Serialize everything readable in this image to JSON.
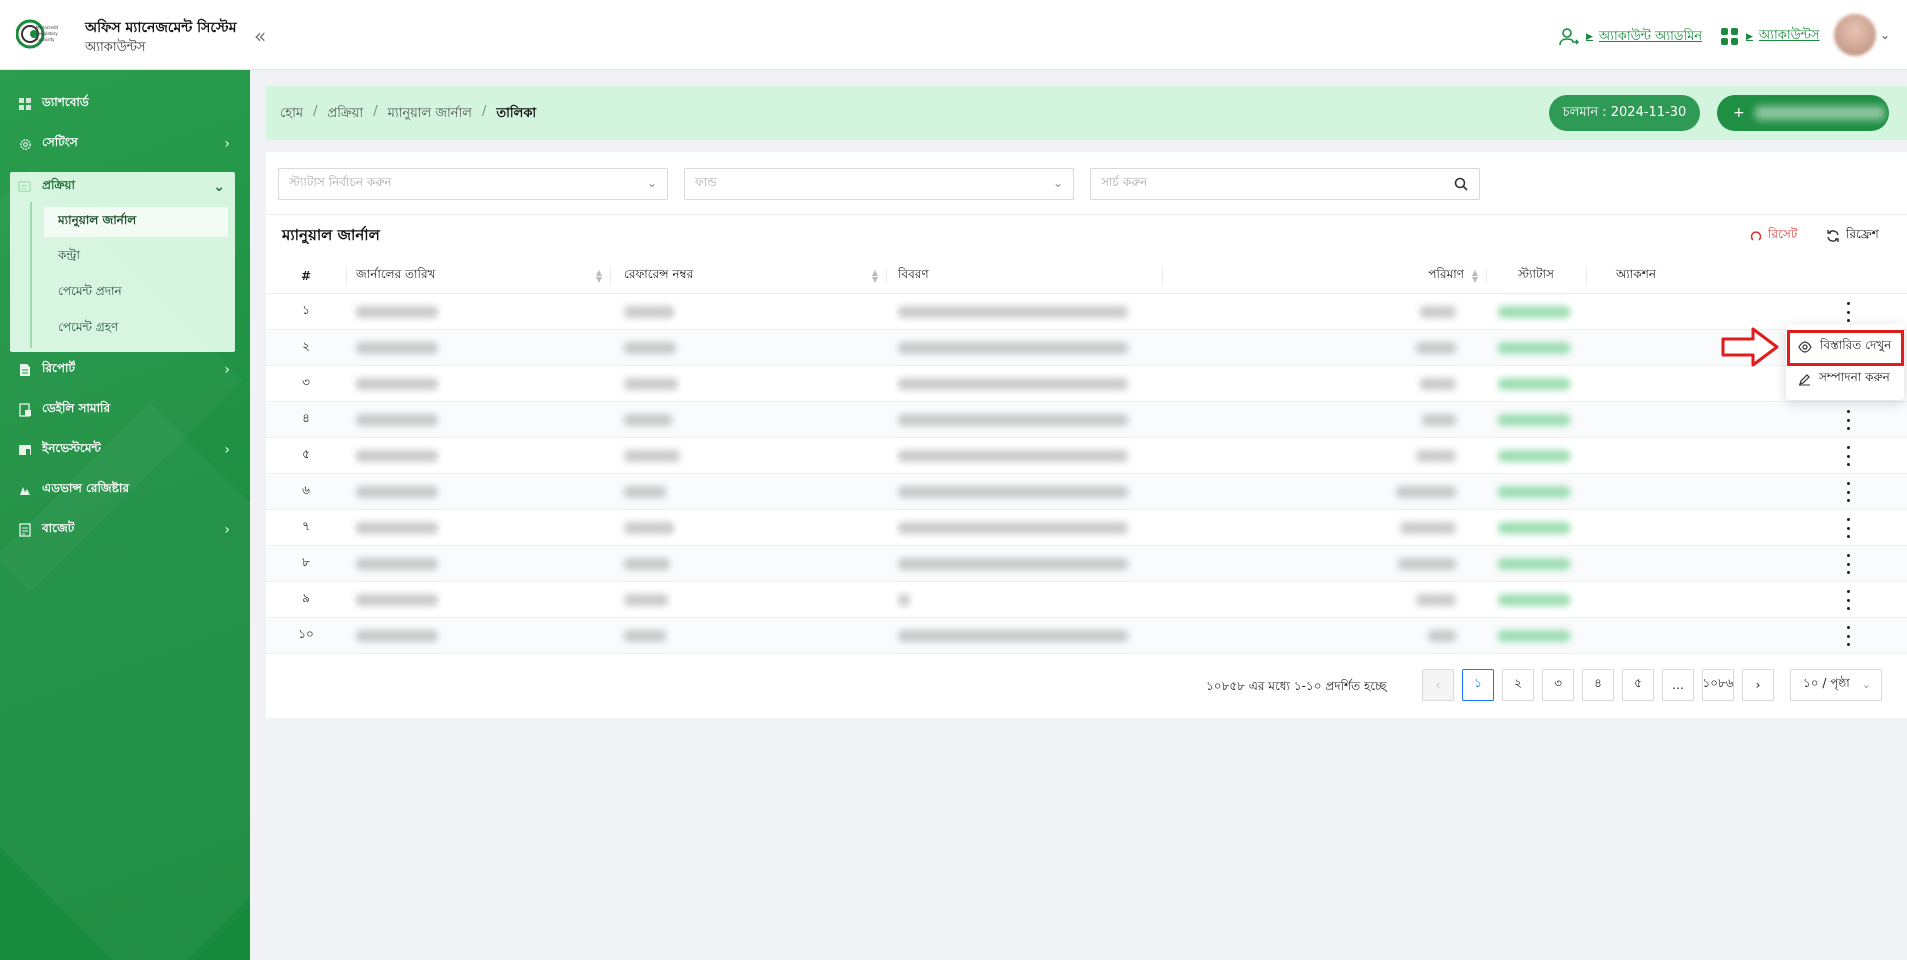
{
  "header": {
    "app_title": "অফিস ম্যানেজমেন্ট সিস্টেম",
    "app_subtitle": "অ্যাকাউন্টস",
    "logo_lines": [
      "Microcredit",
      "Regulatory",
      "Authority"
    ],
    "role_link": "অ্যাকাউন্ট অ্যাডমিন",
    "module_link": "অ্যাকাউন্টস",
    "brand_color": "#1a8a3c"
  },
  "sidebar": {
    "items": [
      {
        "label": "ড্যাশবোর্ড",
        "icon": "dashboard-icon",
        "has_children": false
      },
      {
        "label": "সেটিংস",
        "icon": "gear-icon",
        "has_children": true
      },
      {
        "label": "প্রক্রিয়া",
        "icon": "process-icon",
        "has_children": true,
        "expanded": true
      },
      {
        "label": "রিপোর্ট",
        "icon": "report-icon",
        "has_children": true
      },
      {
        "label": "ডেইলি সামারি",
        "icon": "summary-icon",
        "has_children": false
      },
      {
        "label": "ইনভেস্টমেন্ট",
        "icon": "investment-icon",
        "has_children": true
      },
      {
        "label": "এডভান্স রেজিষ্টার",
        "icon": "register-icon",
        "has_children": false
      },
      {
        "label": "বাজেট",
        "icon": "budget-icon",
        "has_children": true
      }
    ],
    "sub_items": [
      {
        "label": "ম্যানুয়াল জার্নাল",
        "active": true
      },
      {
        "label": "কন্ট্রা",
        "active": false
      },
      {
        "label": "পেমেন্ট প্রদান",
        "active": false
      },
      {
        "label": "পেমেন্ট গ্রহণ",
        "active": false
      }
    ]
  },
  "breadcrumb": {
    "items": [
      "হোম",
      "প্রক্রিয়া",
      "ম্যানুয়াল জার্নাল",
      "তালিকা"
    ],
    "fiscal_year": "চলমান : 2024-11-30",
    "add_button_prefix": "+"
  },
  "filters": {
    "status_placeholder": "স্ট্যাটাস নির্বাচন করুন",
    "fund_placeholder": "ফান্ড",
    "search_placeholder": "সার্চ করুন"
  },
  "table": {
    "title": "ম্যানুয়াল জার্নাল",
    "reset_label": "রিসেট",
    "refresh_label": "রিফ্রেশ",
    "columns": [
      "#",
      "জার্নালের তারিখ",
      "রেফারেন্স নম্বর",
      "বিবরণ",
      "পরিমাণ",
      "স্ট্যাটাস",
      "অ্যাকশন"
    ],
    "rows": [
      {
        "index": "১"
      },
      {
        "index": "২"
      },
      {
        "index": "৩"
      },
      {
        "index": "৪"
      },
      {
        "index": "৫"
      },
      {
        "index": "৬"
      },
      {
        "index": "৭"
      },
      {
        "index": "৮"
      },
      {
        "index": "৯"
      },
      {
        "index": "১০"
      }
    ]
  },
  "pagination": {
    "summary": "১০৮৫৮ এর মধ্যে ১-১০ প্রদর্শিত হচ্ছে",
    "pages": [
      "১",
      "২",
      "৩",
      "৪",
      "৫",
      "…",
      "১০৮৬"
    ],
    "current": "১",
    "page_size": "১০ / পৃষ্ঠা"
  },
  "action_menu": {
    "items": [
      "বিস্তারিত দেখুন",
      "সম্পাদনা করুন"
    ],
    "highlight_color": "#e01b1b"
  }
}
